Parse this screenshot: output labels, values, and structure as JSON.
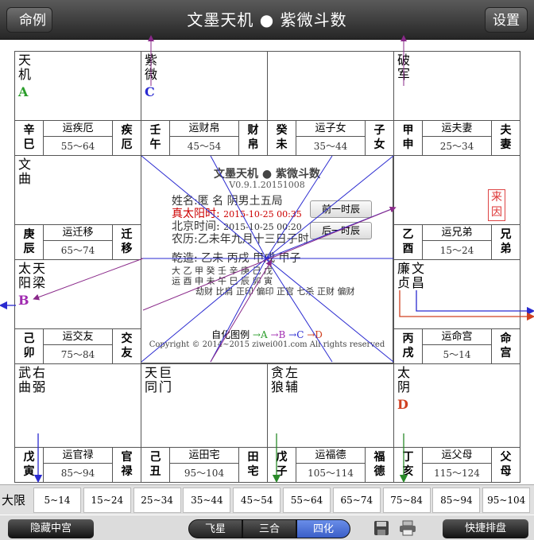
{
  "header": {
    "left_button": "命例",
    "title": "文墨天机 ● 紫微斗数",
    "right_button": "设置"
  },
  "palaces": [
    {
      "stars": [
        [
          "天",
          "机"
        ]
      ],
      "hua": "A",
      "hua_color": "#2a9d2a",
      "ganzhi": [
        "辛",
        "巳"
      ],
      "yun": "运疾厄",
      "range": "55～64",
      "name": [
        "疾",
        "厄"
      ]
    },
    {
      "stars": [
        [
          "紫",
          "微"
        ]
      ],
      "hua": "C",
      "hua_color": "#2a2ad0",
      "ganzhi": [
        "壬",
        "午"
      ],
      "yun": "运财帛",
      "range": "45～54",
      "name": [
        "财",
        "帛"
      ]
    },
    {
      "stars": [],
      "hua": "",
      "hua_color": "",
      "ganzhi": [
        "癸",
        "未"
      ],
      "yun": "运子女",
      "range": "35～44",
      "name": [
        "子",
        "女"
      ]
    },
    {
      "stars": [
        [
          "破",
          "军"
        ]
      ],
      "hua": "",
      "hua_color": "",
      "ganzhi": [
        "甲",
        "申"
      ],
      "yun": "运夫妻",
      "range": "25～34",
      "name": [
        "夫",
        "妻"
      ]
    },
    {
      "stars": [
        [
          "文",
          "曲"
        ]
      ],
      "hua": "",
      "hua_color": "",
      "ganzhi": [
        "庚",
        "辰"
      ],
      "yun": "运迁移",
      "range": "65～74",
      "name": [
        "迁",
        "移"
      ]
    },
    {
      "stars": [],
      "hua": "",
      "hua_color": "",
      "ganzhi": [
        "乙",
        "酉"
      ],
      "yun": "运兄弟",
      "range": "15～24",
      "name": [
        "兄",
        "弟"
      ]
    },
    {
      "stars": [
        [
          "太",
          "阳"
        ],
        [
          "天",
          "梁"
        ]
      ],
      "hua": "B",
      "hua_color": "#a02ab0",
      "ganzhi": [
        "己",
        "卯"
      ],
      "yun": "运交友",
      "range": "75～84",
      "name": [
        "交",
        "友"
      ]
    },
    {
      "stars": [
        [
          "廉",
          "贞"
        ],
        [
          "文",
          "昌"
        ]
      ],
      "hua": "",
      "hua_color": "",
      "ganzhi": [
        "丙",
        "戌"
      ],
      "yun": "运命宫",
      "range": "5～14",
      "name": [
        "命",
        "宫"
      ]
    },
    {
      "stars": [
        [
          "武",
          "曲"
        ],
        [
          "右",
          "弼"
        ]
      ],
      "hua": "",
      "hua_color": "",
      "ganzhi": [
        "戊",
        "寅"
      ],
      "yun": "运官禄",
      "range": "85～94",
      "name": [
        "官",
        "禄"
      ]
    },
    {
      "stars": [
        [
          "天",
          "同"
        ],
        [
          "巨",
          "门"
        ]
      ],
      "hua": "",
      "hua_color": "",
      "ganzhi": [
        "己",
        "丑"
      ],
      "yun": "运田宅",
      "range": "95～104",
      "name": [
        "田",
        "宅"
      ]
    },
    {
      "stars": [
        [
          "贪",
          "狼"
        ],
        [
          "左",
          "辅"
        ]
      ],
      "hua": "",
      "hua_color": "",
      "ganzhi": [
        "戊",
        "子"
      ],
      "yun": "运福德",
      "range": "105～114",
      "name": [
        "福",
        "德"
      ]
    },
    {
      "stars": [
        [
          "太",
          "阴"
        ]
      ],
      "hua": "D",
      "hua_color": "#d04020",
      "ganzhi": [
        "丁",
        "亥"
      ],
      "yun": "运父母",
      "range": "115～124",
      "name": [
        "父",
        "母"
      ]
    }
  ],
  "center": {
    "title": "文墨天机 ● 紫微斗数",
    "version": "V0.9.1.20151008",
    "name_line": "姓名:匿 名    阴男土五局",
    "true_time_label": "真太阳时:",
    "true_time_value": "2015-10-25  00:35",
    "beijing_label": "北京时间:",
    "beijing_value": "2015-10-25  00:20",
    "lunar_line": "农历:乙未年九月十三日子时",
    "qianzao": "乾造: 乙未  丙戌  甲戌  甲子",
    "da_line": "大   乙   甲   癸   壬   辛   庚   己   戊",
    "yun_line": "运   酉   申   未   午   巳   辰   卯   寅",
    "shishen_line": "劫财 比肩 正印 偏印 正官 七杀 正财 偏财",
    "btn_prev": "前一时辰",
    "btn_next": "后一时辰",
    "legend_label": "自化图例",
    "legend_a": "→A",
    "legend_b": "→B",
    "legend_c": "→C",
    "legend_d": "→D",
    "copyright": "Copyright © 2014~2015 ziwei001.com All rights reserved"
  },
  "laiyin": "来因",
  "daxian": {
    "label": "大限",
    "cells": [
      "5~14",
      "15~24",
      "25~34",
      "35~44",
      "45~54",
      "55~64",
      "65~74",
      "75~84",
      "85~94",
      "95~104"
    ]
  },
  "bottom": {
    "hide_button": "隐藏中宫",
    "seg_flying": "飞星",
    "seg_sanhe": "三合",
    "seg_sihua": "四化",
    "quick_button": "快捷排盘"
  },
  "colors": {
    "sihua_a": "#2a9d2a",
    "sihua_b": "#a02ab0",
    "sihua_c": "#2a2ad0",
    "sihua_d": "#d04020",
    "active_segment": "#4a6ed8"
  }
}
